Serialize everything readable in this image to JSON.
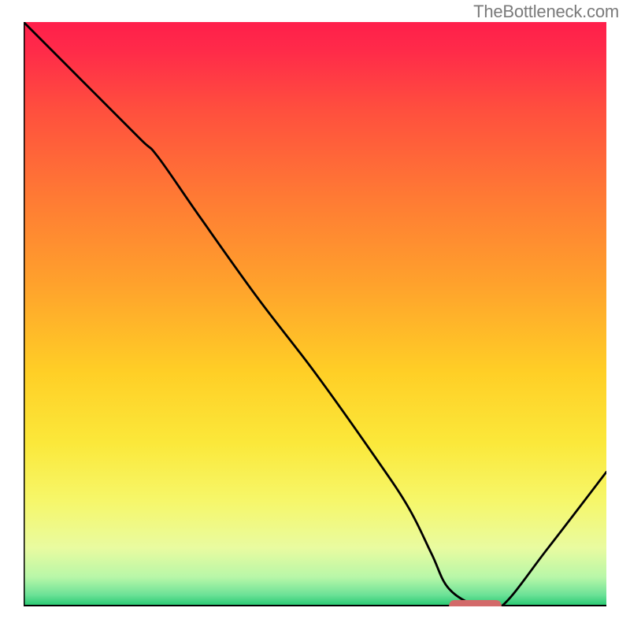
{
  "attribution": "TheBottleneck.com",
  "chart_data": {
    "type": "line",
    "title": "",
    "xlabel": "",
    "ylabel": "",
    "xlim": [
      0,
      100
    ],
    "ylim": [
      0,
      100
    ],
    "background_gradient": {
      "stops": [
        {
          "pos": 0.0,
          "color": "#ff1f4b"
        },
        {
          "pos": 0.05,
          "color": "#ff2b49"
        },
        {
          "pos": 0.15,
          "color": "#ff4f3e"
        },
        {
          "pos": 0.3,
          "color": "#ff7a34"
        },
        {
          "pos": 0.45,
          "color": "#ffa22c"
        },
        {
          "pos": 0.6,
          "color": "#ffcf26"
        },
        {
          "pos": 0.72,
          "color": "#fbe83a"
        },
        {
          "pos": 0.82,
          "color": "#f6f76a"
        },
        {
          "pos": 0.9,
          "color": "#e9fba0"
        },
        {
          "pos": 0.95,
          "color": "#b8f7a8"
        },
        {
          "pos": 0.98,
          "color": "#6de297"
        },
        {
          "pos": 1.0,
          "color": "#23c76f"
        }
      ]
    },
    "series": [
      {
        "name": "curve",
        "x": [
          0,
          10,
          20,
          23,
          30,
          40,
          50,
          60,
          66,
          70,
          73,
          78,
          82,
          90,
          100
        ],
        "y": [
          100,
          90,
          80,
          77,
          67,
          53,
          40,
          26,
          17,
          9,
          3,
          0,
          0,
          10,
          23
        ]
      }
    ],
    "marker": {
      "x_start": 73,
      "x_end": 82,
      "y": 0,
      "color": "#d36a6a"
    }
  }
}
